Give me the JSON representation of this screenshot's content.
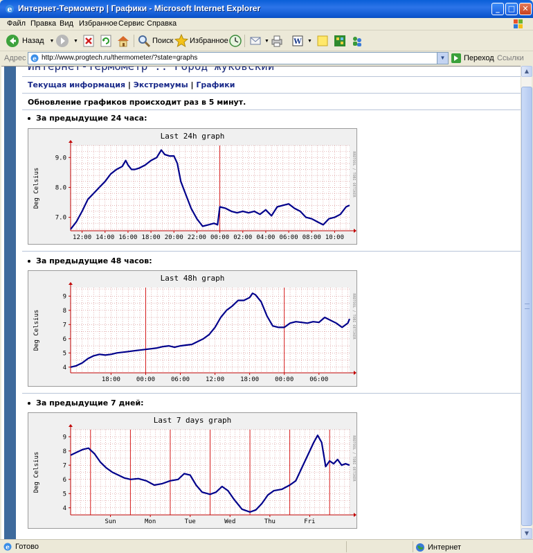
{
  "window": {
    "title": "Интернет-Термометр | Графики - Microsoft Internet Explorer",
    "min": "_",
    "max": "□",
    "close": "✕"
  },
  "menu": [
    "Файл",
    "Правка",
    "Вид",
    "Избранное",
    "Сервис",
    "Справка"
  ],
  "toolbar": {
    "back": "Назад",
    "search": "Поиск",
    "favorites": "Избранное"
  },
  "address": {
    "label": "Адрес",
    "url": "http://www.progtech.ru/thermometer/?state=graphs",
    "go": "Переход",
    "links": "Ссылки"
  },
  "page": {
    "site_title": "Интернет-Термометр :: Город Жуковский",
    "nav": [
      "Текущая информация",
      "Экстремумы",
      "Графики"
    ],
    "nav_sep": " | ",
    "notice": "Обновление графиков происходит раз в 5 минут.",
    "sections": [
      "За предыдущие 24 часа:",
      "За предыдущие 48 часов:",
      "За предыдущие 7 дней:"
    ]
  },
  "status": {
    "text": "Готово",
    "zone": "Интернет"
  },
  "colors": {
    "line": "#00008B",
    "grid_major": "#D00000",
    "grid_minor": "#D08080",
    "plot_bg": "#FFFFFF",
    "frame_bg": "#F0F0F0"
  },
  "chart_data": [
    {
      "type": "line",
      "title": "Last 24h graph",
      "ylabel": "Deg Celsius",
      "side_text": "RRDTOOL / TOBI OETIKER",
      "ylim": [
        6.55,
        9.4
      ],
      "yticks": [
        7.0,
        8.0,
        9.0
      ],
      "ytick_labels": [
        "7.0",
        "8.0",
        "9.0"
      ],
      "xlim": [
        11,
        35.3
      ],
      "xticks": [
        12,
        14,
        16,
        18,
        20,
        22,
        24,
        26,
        28,
        30,
        32,
        34
      ],
      "xtick_labels": [
        "12:00",
        "14:00",
        "16:00",
        "18:00",
        "20:00",
        "22:00",
        "00:00",
        "02:00",
        "04:00",
        "06:00",
        "08:00",
        "10:00"
      ],
      "major_x": [
        24
      ],
      "minor_step_x": 0.5,
      "minor_step_y": 0.2,
      "x": [
        11.0,
        11.5,
        12.0,
        12.5,
        13.0,
        13.5,
        14.0,
        14.5,
        15.0,
        15.5,
        15.8,
        16.0,
        16.3,
        16.6,
        17.0,
        17.5,
        18.0,
        18.5,
        18.9,
        19.2,
        19.6,
        20.0,
        20.3,
        20.6,
        21.0,
        21.5,
        22.0,
        22.5,
        23.0,
        23.5,
        23.8,
        24.0,
        24.5,
        25.0,
        25.5,
        26.0,
        26.5,
        27.0,
        27.5,
        28.0,
        28.5,
        29.0,
        29.5,
        30.0,
        30.5,
        31.0,
        31.5,
        32.0,
        32.5,
        33.0,
        33.5,
        34.0,
        34.5,
        35.0,
        35.3
      ],
      "y": [
        6.6,
        6.85,
        7.2,
        7.6,
        7.8,
        8.0,
        8.2,
        8.45,
        8.6,
        8.7,
        8.9,
        8.75,
        8.6,
        8.6,
        8.65,
        8.75,
        8.9,
        9.0,
        9.25,
        9.1,
        9.05,
        9.05,
        8.8,
        8.2,
        7.8,
        7.3,
        6.95,
        6.7,
        6.75,
        6.8,
        6.75,
        7.35,
        7.3,
        7.2,
        7.15,
        7.2,
        7.15,
        7.2,
        7.1,
        7.25,
        7.05,
        7.35,
        7.4,
        7.45,
        7.3,
        7.2,
        7.0,
        6.95,
        6.85,
        6.75,
        6.95,
        7.0,
        7.1,
        7.35,
        7.4
      ]
    },
    {
      "type": "line",
      "title": "Last 48h graph",
      "ylabel": "Deg Celsius",
      "side_text": "RRDTOOL / TOBI OETIKER",
      "ylim": [
        3.6,
        9.6
      ],
      "yticks": [
        4,
        5,
        6,
        7,
        8,
        9
      ],
      "ytick_labels": [
        "4",
        "5",
        "6",
        "7",
        "8",
        "9"
      ],
      "xlim": [
        11,
        59.3
      ],
      "xticks": [
        18,
        24,
        30,
        36,
        42,
        48,
        54
      ],
      "xtick_labels": [
        "18:00",
        "00:00",
        "06:00",
        "12:00",
        "18:00",
        "00:00",
        "06:00"
      ],
      "major_x": [
        24,
        48
      ],
      "minor_step_x": 1,
      "minor_step_y": 0.5,
      "x": [
        11,
        12,
        13,
        14,
        15,
        16,
        17,
        18,
        19,
        20,
        21,
        22,
        23,
        24,
        25,
        26,
        27,
        28,
        29,
        30,
        31,
        32,
        33,
        34,
        35,
        36,
        37,
        38,
        39,
        40,
        41,
        42,
        42.5,
        43,
        44,
        45,
        46,
        47,
        48,
        49,
        50,
        51,
        52,
        53,
        54,
        55,
        56,
        57,
        58,
        59,
        59.3
      ],
      "y": [
        4.0,
        4.1,
        4.3,
        4.6,
        4.8,
        4.9,
        4.85,
        4.9,
        5.0,
        5.05,
        5.1,
        5.15,
        5.2,
        5.25,
        5.3,
        5.35,
        5.45,
        5.5,
        5.4,
        5.5,
        5.55,
        5.6,
        5.8,
        6.0,
        6.3,
        6.8,
        7.5,
        8.0,
        8.3,
        8.7,
        8.7,
        8.9,
        9.2,
        9.1,
        8.6,
        7.6,
        6.9,
        6.8,
        6.8,
        7.1,
        7.2,
        7.15,
        7.1,
        7.2,
        7.15,
        7.5,
        7.3,
        7.1,
        6.8,
        7.1,
        7.4
      ]
    },
    {
      "type": "line",
      "title": "Last 7 days graph",
      "ylabel": "Deg Celsius",
      "side_text": "RRDTOOL / TOBI OETIKER",
      "ylim": [
        3.5,
        9.5
      ],
      "yticks": [
        4,
        5,
        6,
        7,
        8,
        9
      ],
      "ytick_labels": [
        "4",
        "5",
        "6",
        "7",
        "8",
        "9"
      ],
      "xlim": [
        0,
        7
      ],
      "xticks": [
        1,
        2,
        3,
        4,
        5,
        6
      ],
      "xtick_labels": [
        "Sun",
        "Mon",
        "Tue",
        "Wed",
        "Thu",
        "Fri"
      ],
      "major_x": [
        0.5,
        1.5,
        2.5,
        3.5,
        4.5,
        5.5,
        6.5
      ],
      "minor_step_x": 0.125,
      "minor_step_y": 0.5,
      "x": [
        0.0,
        0.15,
        0.3,
        0.45,
        0.6,
        0.75,
        0.9,
        1.05,
        1.2,
        1.35,
        1.5,
        1.7,
        1.9,
        2.1,
        2.3,
        2.5,
        2.7,
        2.85,
        3.0,
        3.15,
        3.3,
        3.5,
        3.65,
        3.8,
        3.95,
        4.1,
        4.3,
        4.5,
        4.65,
        4.8,
        4.95,
        5.1,
        5.3,
        5.5,
        5.65,
        5.8,
        5.95,
        6.1,
        6.2,
        6.3,
        6.4,
        6.5,
        6.6,
        6.7,
        6.8,
        6.9,
        7.0
      ],
      "y": [
        7.7,
        7.9,
        8.1,
        8.2,
        7.8,
        7.2,
        6.8,
        6.5,
        6.3,
        6.1,
        6.0,
        6.05,
        5.9,
        5.6,
        5.7,
        5.9,
        6.0,
        6.4,
        6.3,
        5.6,
        5.1,
        4.95,
        5.1,
        5.5,
        5.2,
        4.6,
        3.9,
        3.7,
        3.85,
        4.3,
        4.9,
        5.2,
        5.3,
        5.6,
        5.9,
        6.8,
        7.7,
        8.6,
        9.1,
        8.6,
        6.9,
        7.3,
        7.1,
        7.4,
        7.0,
        7.1,
        7.0
      ]
    }
  ]
}
